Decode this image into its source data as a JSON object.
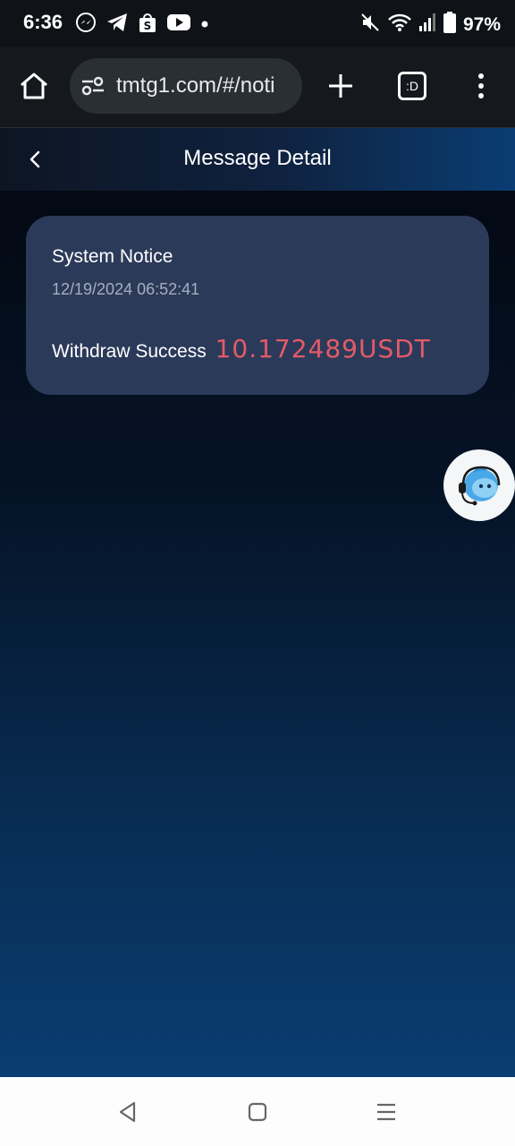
{
  "status_bar": {
    "time": "6:36",
    "battery": "97%",
    "left_icons": [
      "messenger-icon",
      "telegram-icon",
      "shopee-icon",
      "youtube-icon",
      "dot-icon"
    ],
    "right_icons": [
      "mute-icon",
      "wifi-icon",
      "signal-icon",
      "battery-icon"
    ]
  },
  "browser": {
    "url": "tmtg1.com/#/noti",
    "tab_switcher_label": ":D"
  },
  "page": {
    "title": "Message Detail"
  },
  "message": {
    "title": "System Notice",
    "timestamp": "12/19/2024 06:52:41",
    "body_label": "Withdraw Success",
    "amount": "10.172489USDT"
  },
  "colors": {
    "card_bg": "#2c3a5a",
    "amount": "#e35b67",
    "header_gradient_end": "#0a3d73"
  }
}
